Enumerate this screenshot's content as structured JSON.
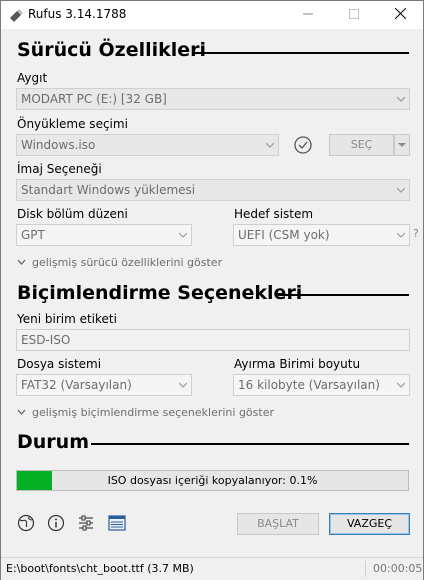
{
  "titlebar": {
    "title": "Rufus 3.14.1788",
    "minimize_icon": "minimize-icon",
    "maximize_icon": "maximize-icon",
    "close_icon": "close-icon"
  },
  "drive": {
    "section_title": "Sürücü Özellikleri",
    "device_label": "Aygıt",
    "device_value": "MODART PC (E:) [32 GB]",
    "boot_label": "Önyükleme seçimi",
    "boot_value": "Windows.iso",
    "select_button": "SEÇ",
    "image_option_label": "İmaj Seçeneği",
    "image_option_value": "Standart Windows yüklemesi",
    "partition_label": "Disk bölüm düzeni",
    "partition_value": "GPT",
    "target_label": "Hedef sistem",
    "target_value": "UEFI (CSM yok)",
    "help_mark": "?",
    "advanced": "gelişmiş sürücü özelliklerini göster"
  },
  "format": {
    "section_title": "Biçimlendirme Seçenekleri",
    "volume_label": "Yeni birim etiketi",
    "volume_value": "ESD-ISO",
    "fs_label": "Dosya sistemi",
    "fs_value": "FAT32 (Varsayılan)",
    "cluster_label": "Ayırma Birimi boyutu",
    "cluster_value": "16 kilobyte (Varsayılan)",
    "advanced": "gelişmiş biçimlendirme seçeneklerini göster"
  },
  "status": {
    "section_title": "Durum",
    "progress_text": "ISO dosyası içeriği kopyalanıyor: 0.1%",
    "progress_fraction": 0.09
  },
  "actions": {
    "start": "BAŞLAT",
    "cancel": "VAZGEÇ"
  },
  "statusbar": {
    "left": "E:\\boot\\fonts\\cht_boot.ttf (3.7 MB)",
    "right": "00:00:05"
  },
  "colors": {
    "progress": "#06b025",
    "primary_border": "#3c7fb1"
  }
}
